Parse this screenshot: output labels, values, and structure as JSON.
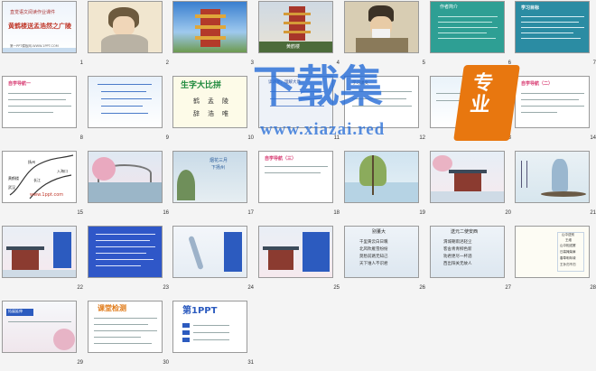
{
  "slides": [
    {
      "num": "1",
      "title": "黄鹤楼送孟浩然之广陵",
      "subtitle": "直觉语文阅读作业课件",
      "footer": "第一PPT模板网-WWW.1PPT.COM"
    },
    {
      "num": "2"
    },
    {
      "num": "3"
    },
    {
      "num": "4",
      "caption": "黄鹤楼"
    },
    {
      "num": "5"
    },
    {
      "num": "6",
      "title": "作者简介"
    },
    {
      "num": "7",
      "title": "学习目标"
    },
    {
      "num": "8",
      "title": "自学导航一"
    },
    {
      "num": "9"
    },
    {
      "num": "10",
      "title": "生字大比拼",
      "words": [
        "鹤",
        "孟",
        "陵",
        "辞",
        "浩",
        "唯"
      ]
    },
    {
      "num": "11",
      "title": "读诗文，理解大意"
    },
    {
      "num": "12",
      "title": "学习课文"
    },
    {
      "num": "13"
    },
    {
      "num": "14",
      "title": "自学导航（二）"
    },
    {
      "num": "15",
      "labels": [
        "黄鹤楼",
        "扬州",
        "武汉",
        "长江",
        "入海口"
      ],
      "site": "www.1ppt.com"
    },
    {
      "num": "16"
    },
    {
      "num": "17",
      "text": [
        "烟花三月",
        "下扬州"
      ]
    },
    {
      "num": "18",
      "title": "自学导航（三）"
    },
    {
      "num": "19"
    },
    {
      "num": "20"
    },
    {
      "num": "21"
    },
    {
      "num": "22"
    },
    {
      "num": "23"
    },
    {
      "num": "24"
    },
    {
      "num": "25"
    },
    {
      "num": "26",
      "title": "别董大",
      "text": [
        "千里黄云白日曛",
        "北风吹雁雪纷纷",
        "莫愁前路无知己",
        "天下谁人不识君"
      ]
    },
    {
      "num": "27",
      "title": "送元二使安西",
      "text": [
        "渭城朝雨浥轻尘",
        "客舍青青柳色新",
        "劝君更尽一杯酒",
        "西出阳关无故人"
      ]
    },
    {
      "num": "28",
      "text": [
        "山中送别",
        "王维",
        "山中相送罢",
        "日暮掩柴扉",
        "春草明年绿",
        "王孙归不归"
      ]
    },
    {
      "num": "29",
      "title": "拓展延伸"
    },
    {
      "num": "30",
      "title": "课堂检测"
    },
    {
      "num": "31",
      "title": "第1PPT"
    }
  ],
  "watermark": {
    "text": "下载集",
    "badge": "专业",
    "url": "www.xiazai.red"
  }
}
